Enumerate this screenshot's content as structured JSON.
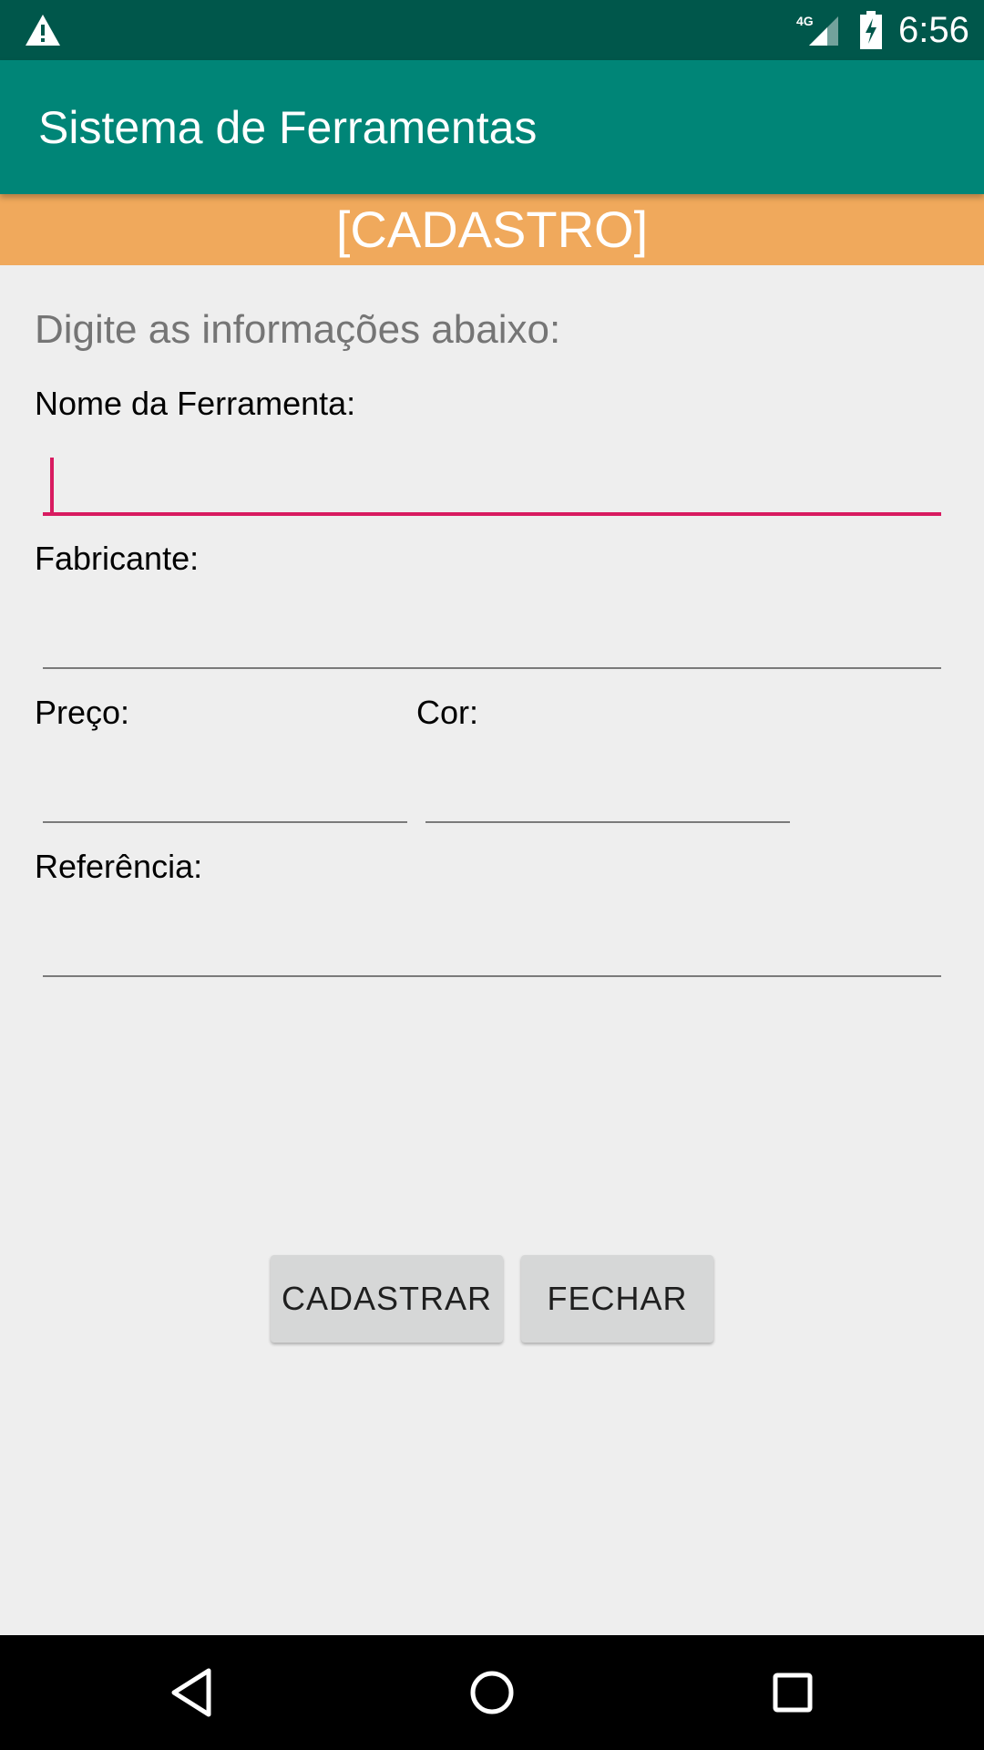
{
  "status_bar": {
    "time": "6:56",
    "network": "4G",
    "icons": [
      "warning-icon",
      "signal-icon",
      "battery-charging-icon"
    ]
  },
  "app_bar": {
    "title": "Sistema de Ferramentas"
  },
  "banner": {
    "text": "[CADASTRO]",
    "color": "#f0a95c"
  },
  "form": {
    "instruction": "Digite as informações abaixo:",
    "fields": {
      "nome": {
        "label": "Nome da Ferramenta:",
        "value": "",
        "focused": true
      },
      "fabricante": {
        "label": "Fabricante:",
        "value": ""
      },
      "preco": {
        "label": "Preço:",
        "value": ""
      },
      "cor": {
        "label": "Cor:",
        "value": ""
      },
      "referencia": {
        "label": "Referência:",
        "value": ""
      }
    }
  },
  "buttons": {
    "cadastrar": "CADASTRAR",
    "fechar": "FECHAR"
  },
  "nav_bar": {
    "icons": [
      "back-icon",
      "home-icon",
      "recents-icon"
    ]
  },
  "colors": {
    "status_bar": "#00574b",
    "app_bar": "#008577",
    "accent": "#d81b60",
    "background": "#eeeeee"
  }
}
